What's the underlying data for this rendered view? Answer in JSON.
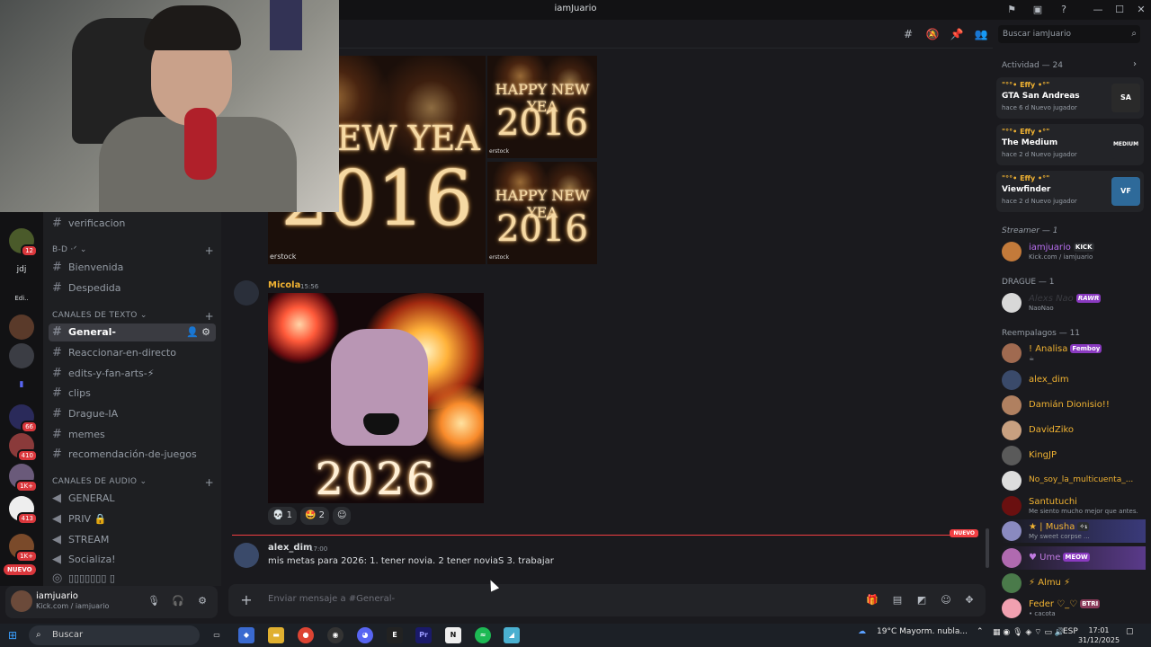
{
  "window": {
    "title": "iamJuario"
  },
  "rail": {
    "servers": [
      {
        "label": "",
        "badge": "12",
        "color": "#4a5a2a"
      },
      {
        "label": "jdj",
        "badge": "",
        "color": "#121214"
      },
      {
        "label": "Edi..",
        "badge": "",
        "color": "#121214"
      },
      {
        "label": "",
        "badge": "",
        "color": "#5a3a2a"
      },
      {
        "label": "",
        "badge": "",
        "color": "#3b3d44"
      },
      {
        "label": "",
        "badge": "",
        "color": "#3a4ad0"
      },
      {
        "label": "",
        "badge": "66",
        "color": "#2a2a5a"
      },
      {
        "label": "",
        "badge": "410",
        "color": "#8a3a3a"
      },
      {
        "label": "",
        "badge": "1K+",
        "color": "#6a5a7a"
      },
      {
        "label": "",
        "badge": "413",
        "color": "#eeeeee"
      },
      {
        "label": "",
        "badge": "1K+",
        "color": "#7a4a2a"
      }
    ],
    "nuevo": "NUEVO"
  },
  "sidebar": {
    "verificacion": "verificacion",
    "cat_bd": "B-D ·ᐟ",
    "bienvenida": "Bienvenida",
    "despedida": "Despedida",
    "cat_texto": "CANALES DE TEXTO",
    "text_channels": [
      "General-",
      "Reaccionar-en-directo",
      "edits-y-fan-arts-⚡",
      "clips",
      "Drague-IA",
      "memes",
      "recomendación-de-juegos"
    ],
    "cat_audio": "CANALES DE AUDIO",
    "voice_channels": [
      "GENERAL",
      "PRIV 🔒",
      "STREAM",
      "Socializa!",
      "▯▯▯▯▯▯▯ ▯"
    ]
  },
  "user": {
    "name": "iamjuario",
    "status": "Kick.com / iamjuario"
  },
  "images": {
    "big_text_top": "Y NEW YEA",
    "big_text_year": "2016",
    "small_text_top": "HAPPY NEW YEA",
    "small_text_year": "2016",
    "watermark": "erstock",
    "watermark_small": "erstock"
  },
  "messages": [
    {
      "author": "Micola",
      "time": "15:56",
      "author_color": "#f0b232",
      "image_text": "2026"
    },
    {
      "author": "alex_dim",
      "time": "17:00",
      "author_color": "#f0b232",
      "text": "mis metas para 2026: 1. tener novia. 2 tener noviaS 3. trabajar"
    }
  ],
  "reactions": [
    {
      "emoji": "💀",
      "count": "1"
    },
    {
      "emoji": "🤩",
      "count": "2"
    },
    {
      "emoji": "☺",
      "count": ""
    }
  ],
  "divider_label": "NUEVO",
  "composer": {
    "placeholder": "Enviar mensaje a #General-"
  },
  "members": {
    "search_placeholder": "Buscar iamJuario",
    "activity_header": "Actividad — 24",
    "activities": [
      {
        "user": "\"°°• Effy •°\"",
        "game": "GTA San Andreas",
        "meta": "hace 6 d   Nuevo jugador",
        "thumb": "SA"
      },
      {
        "user": "\"°°• Effy •°\"",
        "game": "The Medium",
        "meta": "hace 2 d   Nuevo jugador",
        "thumb": "MEDIUM"
      },
      {
        "user": "\"°°• Effy •°\"",
        "game": "Viewfinder",
        "meta": "hace 2 d   Nuevo jugador",
        "thumb": "VF"
      }
    ],
    "groups": [
      {
        "label": "Streamer — 1",
        "items": [
          {
            "name": "iamjuario",
            "tag": "KICK",
            "status": "Kick.com / iamjuario",
            "color": "#b86ef0",
            "avatar": "#c37a3a"
          }
        ]
      },
      {
        "label": "DRAGUE — 1",
        "items": [
          {
            "name": "Alexs Nao",
            "tag": "RAWR",
            "status": "NaoNao",
            "color": "#3a3b41",
            "avatar": "#d8d8d8"
          }
        ]
      },
      {
        "label": "Reempalagos — 11",
        "items": [
          {
            "name": "! Analisa",
            "tag": "Femboy",
            "status": "☕",
            "color": "#f0b232",
            "avatar": "#a06a50"
          },
          {
            "name": "alex_dim",
            "tag": "",
            "status": "",
            "color": "#f0b232",
            "avatar": "#3a4a6a"
          },
          {
            "name": "Damián Dionisio!!",
            "tag": "",
            "status": "",
            "color": "#f0b232",
            "avatar": "#b08060"
          },
          {
            "name": "DavidZiko",
            "tag": "",
            "status": "",
            "color": "#f0b232",
            "avatar": "#c8a080"
          },
          {
            "name": "KingJP",
            "tag": "",
            "status": "",
            "color": "#f0b232",
            "avatar": "#5a5a5a"
          },
          {
            "name": "No_soy_la_multicuenta_...",
            "tag": "",
            "status": "",
            "color": "#f0b232",
            "avatar": "#dddddd"
          },
          {
            "name": "Santutuchi",
            "tag": "",
            "status": "Me siento mucho mejor que antes.",
            "color": "#f0b232",
            "avatar": "#6a1010"
          },
          {
            "name": "★ | Musha",
            "tag": "✧₁",
            "status": "My sweet corpse ...",
            "color": "#f0b232",
            "avatar": "#8a8ac0"
          },
          {
            "name": "♥ Ume",
            "tag": "MEOW",
            "status": "",
            "color": "#c07ae0",
            "avatar": "#b06ab0"
          },
          {
            "name": "⚡ Almu ⚡",
            "tag": "",
            "status": "",
            "color": "#f0b232",
            "avatar": "#4a7a4a"
          },
          {
            "name": "Feder ♡_♡",
            "tag": "BTRI",
            "status": "• cacota",
            "color": "#f0b232",
            "avatar": "#f0a0b0"
          }
        ]
      }
    ]
  },
  "taskbar": {
    "search": "Buscar",
    "weather": "19°C  Mayorm. nubla...",
    "lang": "ESP",
    "time": "17:01",
    "date": "31/12/2025"
  }
}
